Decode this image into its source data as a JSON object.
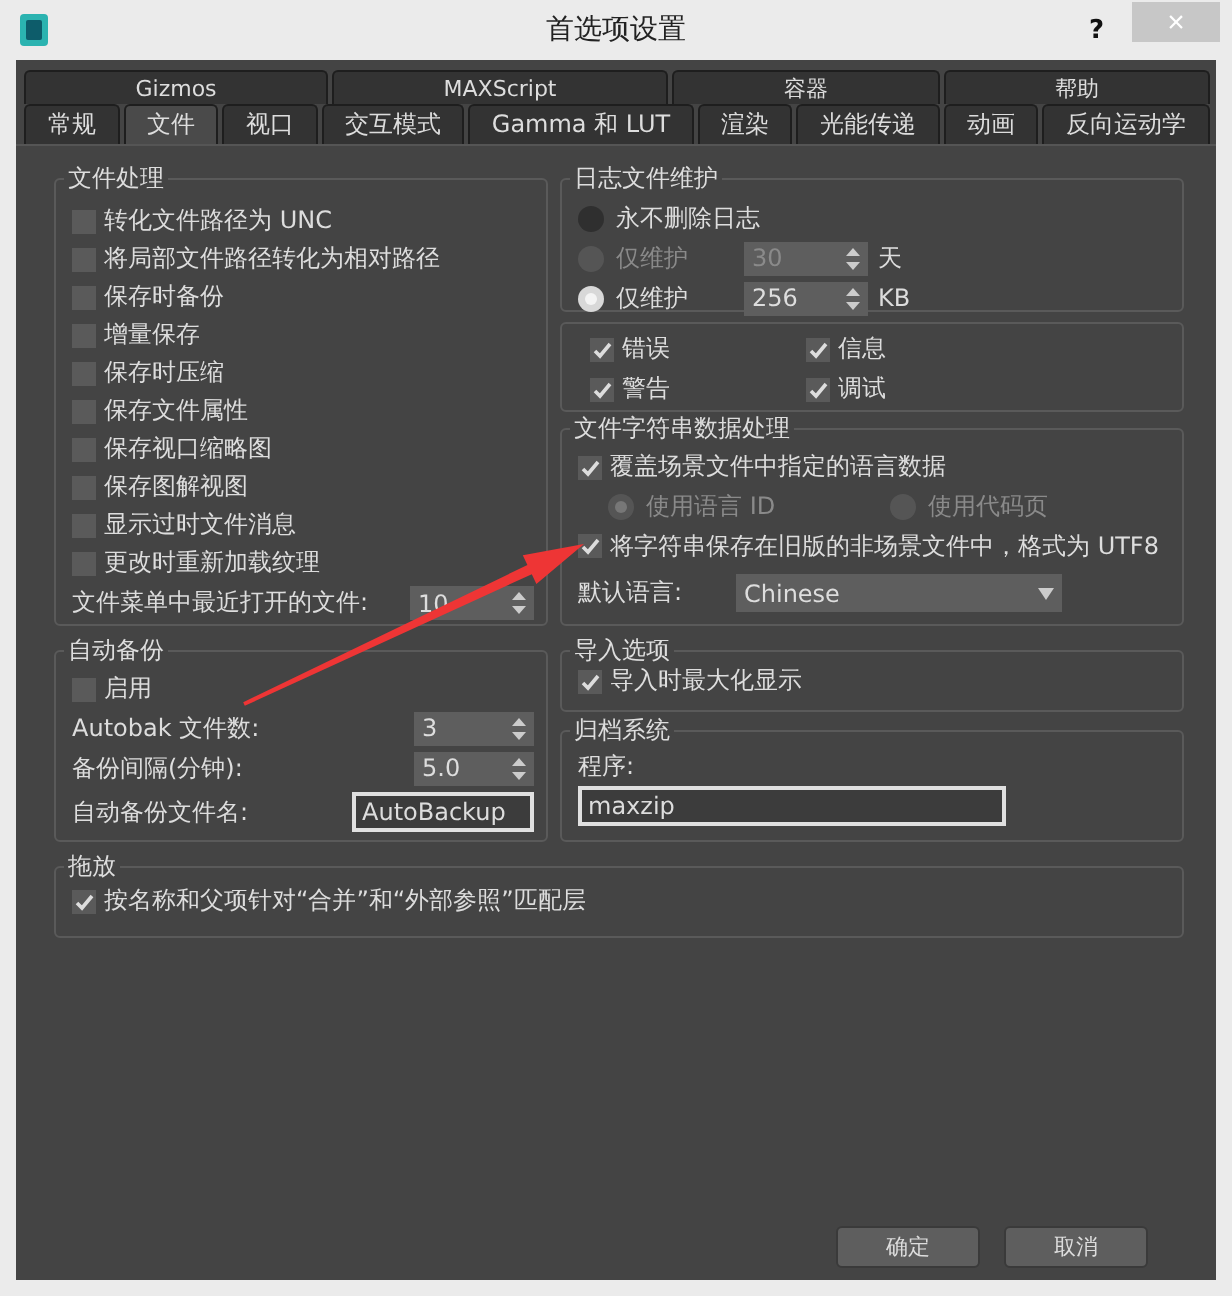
{
  "window": {
    "title": "首选项设置",
    "help_button": "?",
    "close_button": "×"
  },
  "tab_rows": [
    [
      {
        "label": "Gizmos",
        "selected": false
      },
      {
        "label": "MAXScript",
        "selected": false
      },
      {
        "label": "容器",
        "selected": false
      },
      {
        "label": "帮助",
        "selected": false
      }
    ],
    [
      {
        "label": "常规",
        "selected": false
      },
      {
        "label": "文件",
        "selected": true
      },
      {
        "label": "视口",
        "selected": false
      },
      {
        "label": "交互模式",
        "selected": false
      },
      {
        "label": "Gamma 和 LUT",
        "selected": false
      },
      {
        "label": "渲染",
        "selected": false
      },
      {
        "label": "光能传递",
        "selected": false
      },
      {
        "label": "动画",
        "selected": false
      },
      {
        "label": "反向运动学",
        "selected": false
      }
    ]
  ],
  "file_handling": {
    "title": "文件处理",
    "options": [
      {
        "label": "转化文件路径为 UNC",
        "checked": false
      },
      {
        "label": "将局部文件路径转化为相对路径",
        "checked": false
      },
      {
        "label": "保存时备份",
        "checked": false
      },
      {
        "label": "增量保存",
        "checked": false
      },
      {
        "label": "保存时压缩",
        "checked": false
      },
      {
        "label": "保存文件属性",
        "checked": false
      },
      {
        "label": "保存视口缩略图",
        "checked": false
      },
      {
        "label": "保存图解视图",
        "checked": false
      },
      {
        "label": "显示过时文件消息",
        "checked": false
      },
      {
        "label": "更改时重新加载纹理",
        "checked": false
      }
    ],
    "recent_files": {
      "label": "文件菜单中最近打开的文件:",
      "value": "10"
    }
  },
  "log_maintenance": {
    "title": "日志文件维护",
    "options": [
      {
        "label": "永不删除日志",
        "selected": false
      },
      {
        "label": "仅维护",
        "selected": false,
        "value": "30",
        "unit": "天",
        "disabled": true
      },
      {
        "label": "仅维护",
        "selected": true,
        "value": "256",
        "unit": "KB",
        "disabled": false
      }
    ],
    "levels": [
      {
        "label": "错误",
        "checked": true
      },
      {
        "label": "信息",
        "checked": true
      },
      {
        "label": "警告",
        "checked": true
      },
      {
        "label": "调试",
        "checked": true
      }
    ]
  },
  "string_handling": {
    "title": "文件字符串数据处理",
    "override": {
      "label": "覆盖场景文件中指定的语言数据",
      "checked": true
    },
    "language_options": [
      {
        "label": "使用语言 ID",
        "selected": true,
        "disabled": true
      },
      {
        "label": "使用代码页",
        "selected": false,
        "disabled": true
      }
    ],
    "save_utf8": {
      "label": "将字符串保存在旧版的非场景文件中，格式为 UTF8",
      "checked": true
    },
    "default_language": {
      "label": "默认语言:",
      "value": "Chinese"
    }
  },
  "auto_backup": {
    "title": "自动备份",
    "enable": {
      "label": "启用",
      "checked": false
    },
    "fields": [
      {
        "label": "Autobak 文件数:",
        "value": "3",
        "kind": "spinner"
      },
      {
        "label": "备份间隔(分钟):",
        "value": "5.0",
        "kind": "spinner"
      },
      {
        "label": "自动备份文件名:",
        "value": "AutoBackup",
        "kind": "text"
      }
    ]
  },
  "import_options": {
    "title": "导入选项",
    "options": [
      {
        "label": "导入时最大化显示",
        "checked": true
      }
    ]
  },
  "archive_system": {
    "title": "归档系统",
    "program": {
      "label": "程序:",
      "value": "maxzip"
    }
  },
  "drag_drop": {
    "title": "拖放",
    "options": [
      {
        "label": "按名称和父项针对“合并”和“外部参照”匹配层",
        "checked": true
      }
    ]
  },
  "buttons": [
    "确定",
    "取消"
  ]
}
